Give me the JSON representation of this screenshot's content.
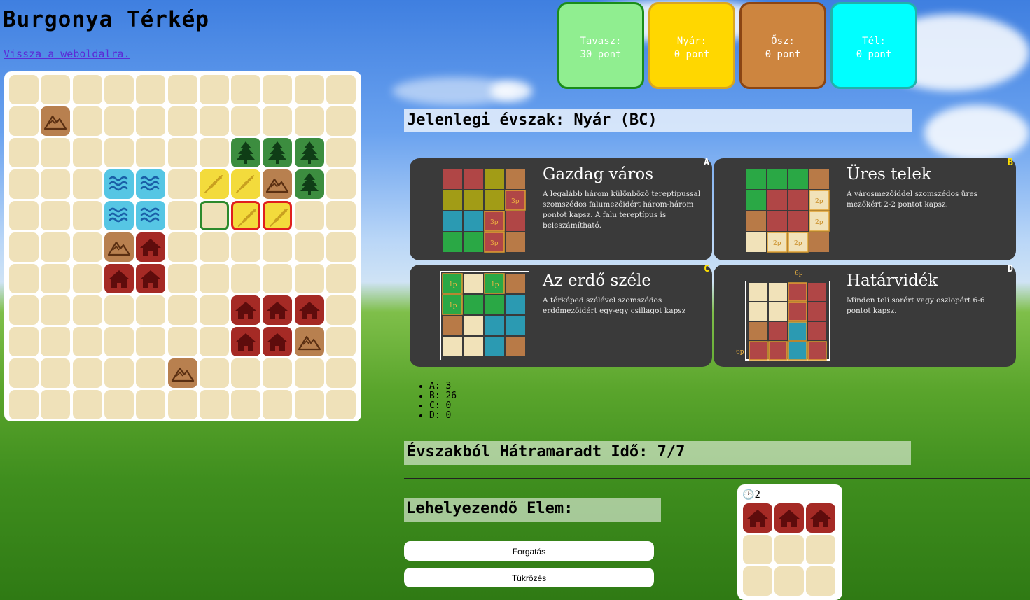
{
  "title": "Burgonya Térkép",
  "back_link": "Vissza a weboldalra.",
  "board": {
    "size": 11,
    "cells": [
      {
        "r": 1,
        "c": 1,
        "t": "mountain"
      },
      {
        "r": 2,
        "c": 7,
        "t": "forest"
      },
      {
        "r": 2,
        "c": 8,
        "t": "forest"
      },
      {
        "r": 2,
        "c": 9,
        "t": "forest"
      },
      {
        "r": 3,
        "c": 3,
        "t": "water"
      },
      {
        "r": 3,
        "c": 4,
        "t": "water"
      },
      {
        "r": 3,
        "c": 6,
        "t": "farm"
      },
      {
        "r": 3,
        "c": 7,
        "t": "farm"
      },
      {
        "r": 3,
        "c": 8,
        "t": "mountain"
      },
      {
        "r": 3,
        "c": 9,
        "t": "forest"
      },
      {
        "r": 4,
        "c": 3,
        "t": "water"
      },
      {
        "r": 4,
        "c": 4,
        "t": "water"
      },
      {
        "r": 4,
        "c": 6,
        "t": "empty",
        "hl": "green"
      },
      {
        "r": 4,
        "c": 7,
        "t": "farm",
        "hl": "red"
      },
      {
        "r": 4,
        "c": 8,
        "t": "farm",
        "hl": "red"
      },
      {
        "r": 5,
        "c": 3,
        "t": "mountain"
      },
      {
        "r": 5,
        "c": 4,
        "t": "village"
      },
      {
        "r": 6,
        "c": 3,
        "t": "village"
      },
      {
        "r": 6,
        "c": 4,
        "t": "village"
      },
      {
        "r": 7,
        "c": 7,
        "t": "village"
      },
      {
        "r": 7,
        "c": 8,
        "t": "village"
      },
      {
        "r": 7,
        "c": 9,
        "t": "village"
      },
      {
        "r": 8,
        "c": 7,
        "t": "village"
      },
      {
        "r": 8,
        "c": 8,
        "t": "village"
      },
      {
        "r": 8,
        "c": 9,
        "t": "mountain"
      },
      {
        "r": 9,
        "c": 5,
        "t": "mountain"
      }
    ]
  },
  "seasons": [
    {
      "name": "Tavasz:",
      "points": "30 pont",
      "bg": "#90ee90",
      "border": "#1a8c1a"
    },
    {
      "name": "Nyár:",
      "points": "0 pont",
      "bg": "#ffd700",
      "border": "#d9a520"
    },
    {
      "name": "Ősz:",
      "points": "0 pont",
      "bg": "#cd853f",
      "border": "#8b4513"
    },
    {
      "name": "Tél:",
      "points": "0 pont",
      "bg": "#00ffff",
      "border": "#20b2aa"
    }
  ],
  "current_season": "Jelenlegi évszak: Nyár (BC)",
  "cards": [
    {
      "letter": "A",
      "title": "Gazdag város",
      "desc": "A legalább három különböző tereptípussal szomszédos falumezőidért három-három pontot kapsz. A falu tereptípus is beleszámítható."
    },
    {
      "letter": "B",
      "title": "Üres telek",
      "desc": "A városmezőiddel szomszédos üres mezőkért 2-2 pontot kapsz."
    },
    {
      "letter": "C",
      "title": "Az erdő széle",
      "desc": "A térképed szélével szomszédos erdőmezőidért egy-egy csillagot kapsz"
    },
    {
      "letter": "D",
      "title": "Határvidék",
      "desc": "Minden teli sorért vagy oszlopért 6-6 pontot kapsz."
    }
  ],
  "card_labels": {
    "three_p": "3p",
    "two_p": "2p",
    "one_p": "1p",
    "six_p": "6p"
  },
  "scores": [
    "A: 3",
    "B: 26",
    "C: 0",
    "D: 0"
  ],
  "time_left": "Évszakból Hátramaradt Idő: 7/7",
  "place_label": "Lehelyezendő Elem:",
  "rotate_button": "Forgatás",
  "mirror_button": "Tükrözés",
  "piece": {
    "time": "2",
    "cells": [
      [
        "village",
        "village",
        "village"
      ],
      [
        "empty",
        "empty",
        "empty"
      ],
      [
        "empty",
        "empty",
        "empty"
      ]
    ]
  },
  "colors": {
    "empty": "#efe1b9",
    "mountain": "#b8804f",
    "forest": "#3c8d3f",
    "water": "#56c6e4",
    "farm": "#f3db3c",
    "village": "#a52a25"
  },
  "icons": {
    "mountain": "mountain-icon",
    "forest": "tree-icon",
    "water": "water-icon",
    "farm": "wheat-icon",
    "village": "house-icon",
    "clock": "clock-icon"
  }
}
